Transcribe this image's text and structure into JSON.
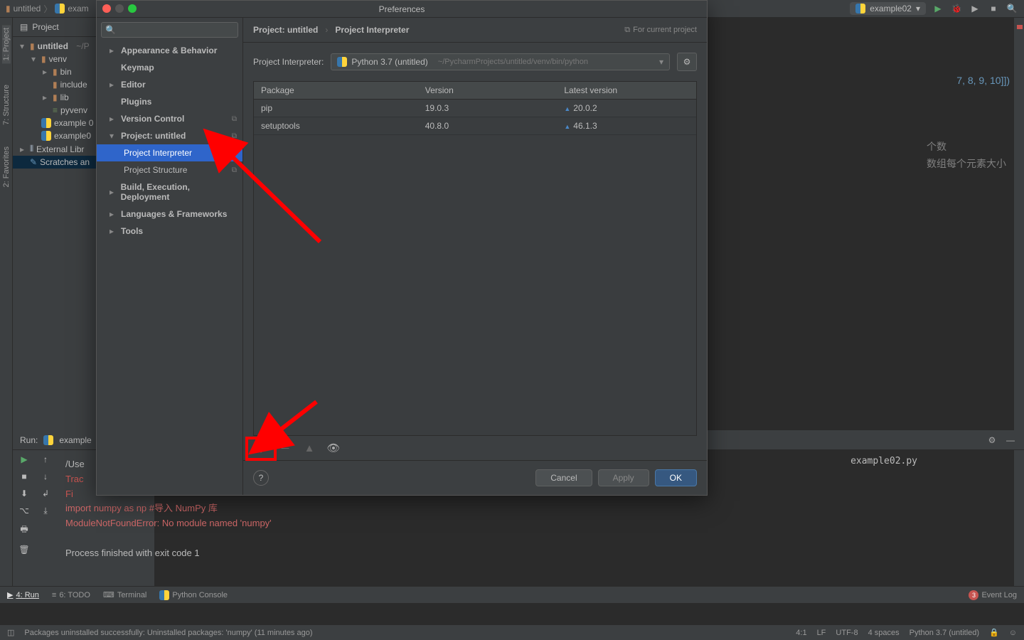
{
  "breadcrumb": {
    "a": "untitled",
    "b": "exam"
  },
  "runconfig": {
    "name": "example02"
  },
  "projectHeader": "Project",
  "tree": {
    "root": "untitled",
    "rootHint": "~/P",
    "venv": "venv",
    "bin": "bin",
    "include": "include",
    "lib": "lib",
    "pyvenv": "pyvenv",
    "ex0": "example 0",
    "ex0b": "example0",
    "extlib": "External Libr",
    "scratches": "Scratches an"
  },
  "sideTabs": {
    "project": "1: Project",
    "structure": "7: Structure",
    "favorites": "2: Favorites"
  },
  "codeFrag": {
    "line1_tail": "7, 8, 9, 10]])",
    "c1": "个数",
    "c2": "数组每个元素大小"
  },
  "runHdr": {
    "label": "Run:",
    "name": "example"
  },
  "console": {
    "l1": "/Use",
    "l2": "Trac",
    "l3": "  Fi",
    "l4": "    import numpy as np #导入 NumPy 库",
    "l5": "ModuleNotFoundError: No module named 'numpy'",
    "l6": "Process finished with exit code 1",
    "tail": "example02.py"
  },
  "btm": {
    "run": "4: Run",
    "todo": "6: TODO",
    "terminal": "Terminal",
    "pyconsole": "Python Console",
    "eventlog": "Event Log",
    "badge": "3"
  },
  "status": {
    "msg": "Packages uninstalled successfully: Uninstalled packages: 'numpy' (11 minutes ago)",
    "pos": "4:1",
    "le": "LF",
    "enc": "UTF-8",
    "ind": "4 spaces",
    "interp": "Python 3.7 (untitled)"
  },
  "prefs": {
    "title": "Preferences",
    "cats": {
      "appearance": "Appearance & Behavior",
      "keymap": "Keymap",
      "editor": "Editor",
      "plugins": "Plugins",
      "vcs": "Version Control",
      "project": "Project: untitled",
      "pi": "Project Interpreter",
      "ps": "Project Structure",
      "build": "Build, Execution, Deployment",
      "lang": "Languages & Frameworks",
      "tools": "Tools"
    },
    "crumb": {
      "a": "Project: untitled",
      "b": "Project Interpreter",
      "hint": "For current project"
    },
    "interp": {
      "label": "Project Interpreter:",
      "name": "Python 3.7 (untitled)",
      "path": "~/PycharmProjects/untitled/venv/bin/python"
    },
    "table": {
      "h1": "Package",
      "h2": "Version",
      "h3": "Latest version",
      "rows": [
        {
          "p": "pip",
          "v": "19.0.3",
          "l": "20.0.2"
        },
        {
          "p": "setuptools",
          "v": "40.8.0",
          "l": "46.1.3"
        }
      ]
    },
    "btns": {
      "cancel": "Cancel",
      "apply": "Apply",
      "ok": "OK"
    }
  }
}
